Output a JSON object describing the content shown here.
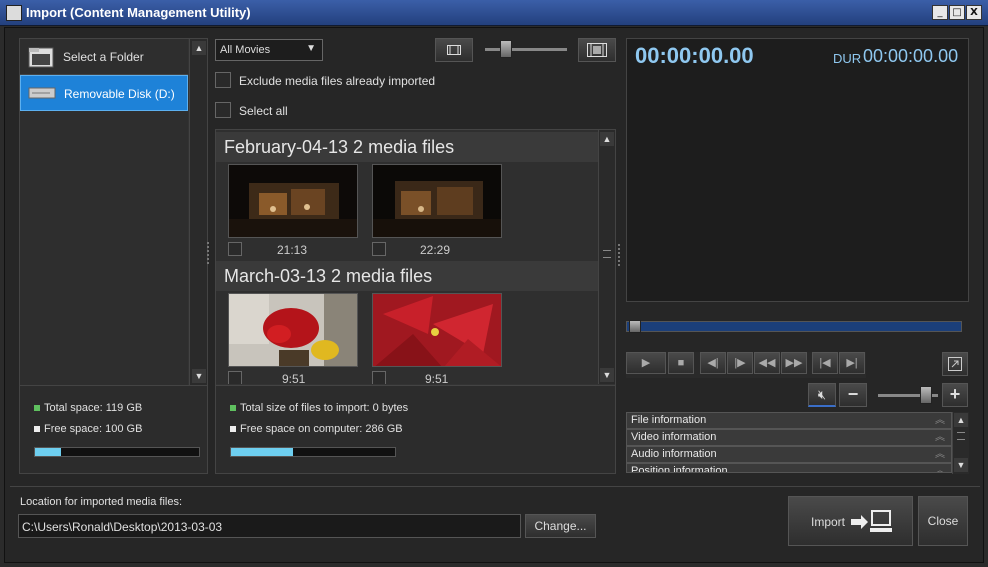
{
  "window": {
    "title": "Import (Content Management Utility)",
    "min": "_",
    "max": "□",
    "close": "X"
  },
  "sources": {
    "items": [
      {
        "label": "Select a Folder",
        "icon": "folder-icon",
        "selected": false
      },
      {
        "label": "Removable Disk (D:)",
        "icon": "drive-icon",
        "selected": true
      }
    ]
  },
  "storage": {
    "total": "Total space: 119 GB",
    "free": "Free space: 100 GB",
    "used_fraction": 0.16
  },
  "filter": {
    "selected": "All Movies",
    "exclude_label": "Exclude media files already imported",
    "select_all_label": "Select all"
  },
  "groups": [
    {
      "header": "February-04-13 2 media files",
      "items": [
        {
          "duration": "21:13",
          "kind": "stage"
        },
        {
          "duration": "22:29",
          "kind": "stage"
        }
      ]
    },
    {
      "header": "March-03-13 2 media files",
      "items": [
        {
          "duration": "9:51",
          "kind": "poinsettia-room"
        },
        {
          "duration": "9:51",
          "kind": "poinsettia-close"
        }
      ]
    }
  ],
  "import_summary": {
    "total_size": "Total size of files to import: 0 bytes",
    "free_computer": "Free space on computer: 286 GB",
    "used_fraction": 0.38
  },
  "player": {
    "timecode": "00:00:00.00",
    "dur_label": "DUR",
    "dur_value": "00:00:00.00"
  },
  "info_sections": [
    "File information",
    "Video information",
    "Audio information",
    "Position information"
  ],
  "location": {
    "label": "Location for imported media files:",
    "path": "C:\\Users\\Ronald\\Desktop\\2013-03-03",
    "change_label": "Change..."
  },
  "actions": {
    "import_label": "Import",
    "close_label": "Close"
  },
  "colors": {
    "accent": "#1e82d8",
    "timecode": "#8fc8f0",
    "progress": "#6ecff0"
  }
}
